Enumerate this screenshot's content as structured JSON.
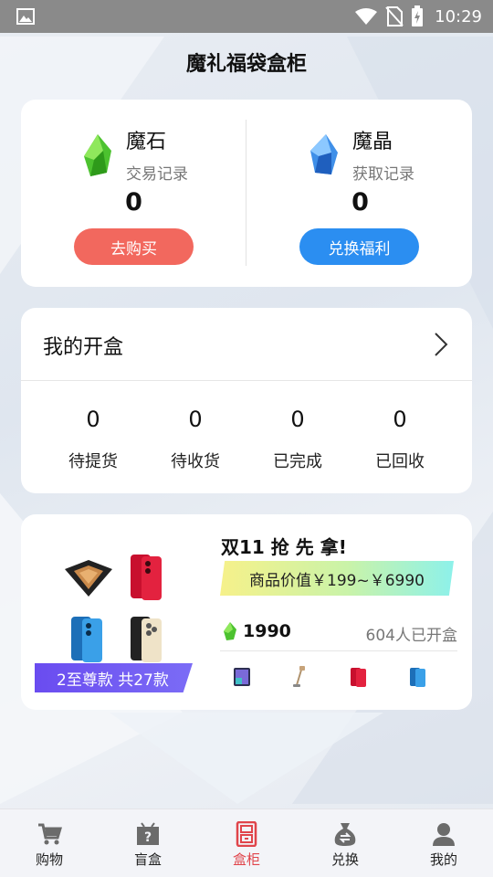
{
  "status_bar": {
    "time": "10:29",
    "left_icon": "image-icon",
    "right_icons": [
      "wifi-icon",
      "no-sim-icon",
      "battery-charging-icon"
    ]
  },
  "page": {
    "title": "魔礼福袋盒柜"
  },
  "wallet": {
    "stone": {
      "name": "魔石",
      "link": "交易记录",
      "balance": "0",
      "button": "去购买",
      "icon": "green-gem-icon",
      "button_color": "#f2685e"
    },
    "crystal": {
      "name": "魔晶",
      "link": "获取记录",
      "balance": "0",
      "button": "兑换福利",
      "icon": "blue-crystal-icon",
      "button_color": "#2b8ef1"
    }
  },
  "my_boxes": {
    "title": "我的开盒",
    "stats": [
      {
        "value": "0",
        "label": "待提货"
      },
      {
        "value": "0",
        "label": "待收货"
      },
      {
        "value": "0",
        "label": "已完成"
      },
      {
        "value": "0",
        "label": "已回收"
      }
    ]
  },
  "promo": {
    "title": "双11 抢 先 拿!",
    "price_range": "商品价值￥199~￥6990",
    "badge": "2至尊款 共27款",
    "price": "1990",
    "opened": "604人已开盒",
    "products": [
      "folding-phone-image",
      "red-phone-image",
      "blue-phone-image",
      "gold-phone-image"
    ],
    "thumbnails": [
      "tablet-thumbnail",
      "vacuum-thumbnail",
      "red-phone-thumbnail",
      "blue-phone-thumbnail"
    ]
  },
  "tabbar": {
    "active": "盒柜",
    "active_color": "#e0454b",
    "tabs": [
      {
        "label": "购物",
        "icon": "cart-icon"
      },
      {
        "label": "盲盒",
        "icon": "mystery-box-icon"
      },
      {
        "label": "盒柜",
        "icon": "cabinet-icon"
      },
      {
        "label": "兑换",
        "icon": "exchange-bag-icon"
      },
      {
        "label": "我的",
        "icon": "user-icon"
      }
    ]
  }
}
